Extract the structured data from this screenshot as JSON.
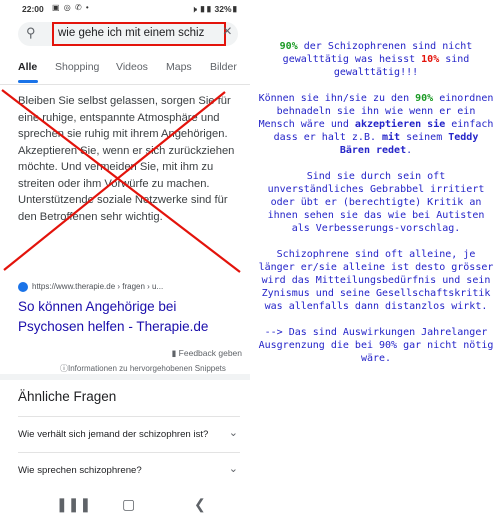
{
  "status_bar": {
    "time": "22:00",
    "notifications": "▣ ◎ ✆ •",
    "right": "🕨 ▮▮ 32%▮"
  },
  "search": {
    "query": "wie gehe ich mit einem schiz"
  },
  "tabs": [
    "Alle",
    "Shopping",
    "Videos",
    "Maps",
    "Bilder"
  ],
  "snippet": {
    "text": "Bleiben Sie selbst gelassen, sorgen Sie für eine ruhige, entspannte Atmosphäre und sprechen sie ruhig mit ihrem Angehörigen. Akzeptieren Sie, wenn er sich zurückziehen möchte. Und vermeiden Sie, mit ihm zu streiten oder ihm Vorwürfe zu machen. Unterstützende soziale Netzwerke sind für den Betroffenen sehr wichtig.",
    "source": "https://www.therapie.de › fragen › u...",
    "title": "So können Angehörige bei Psychosen helfen - Therapie.de"
  },
  "feedback_label": "Feedback geben",
  "info_label": "Informationen zu hervorgehobenen Snippets",
  "related": {
    "heading": "Ähnliche Fragen",
    "questions": [
      "Wie verhält sich jemand der schizophren ist?",
      "Wie sprechen schizophrene?"
    ]
  },
  "colors": {
    "accent_red": "#e3130b",
    "link_blue": "#1a0dab",
    "comment_blue": "#2424c8",
    "comment_green": "#1a9a24"
  },
  "comment": {
    "p1_a": "90%",
    "p1_b": " der Schizophrenen sind nicht gewalttätig was heisst ",
    "p1_c": "10%",
    "p1_d": " sind gewalttätig!!!",
    "p2_a": "Können sie ihn/sie zu den ",
    "p2_b": "90%",
    "p2_c": " einordnen behnadeln sie ihn wie wenn er ein Mensch wäre und ",
    "p2_d": "akzeptieren sie",
    "p2_e": " einfach dass er halt z.B. ",
    "p2_f": "mit",
    "p2_g": " seinem ",
    "p2_h": "Teddy Bären redet",
    "p2_i": ".",
    "p3": "Sind sie durch sein oft unverständliches Gebrabbel irritiert oder übt er (berechtigte) Kritik an ihnen sehen sie das wie bei Autisten als Verbesserungs-vorschlag.",
    "p4": "Schizophrene sind oft alleine, je länger er/sie alleine ist desto grösser wird das Mitteilungsbedürfnis und sein Zynismus und seine Gesellschaftskritik was allenfalls dann distanzlos wirkt.",
    "p5": "--> Das sind Auswirkungen Jahrelanger Ausgrenzung die bei 90% gar nicht nötig wäre."
  }
}
